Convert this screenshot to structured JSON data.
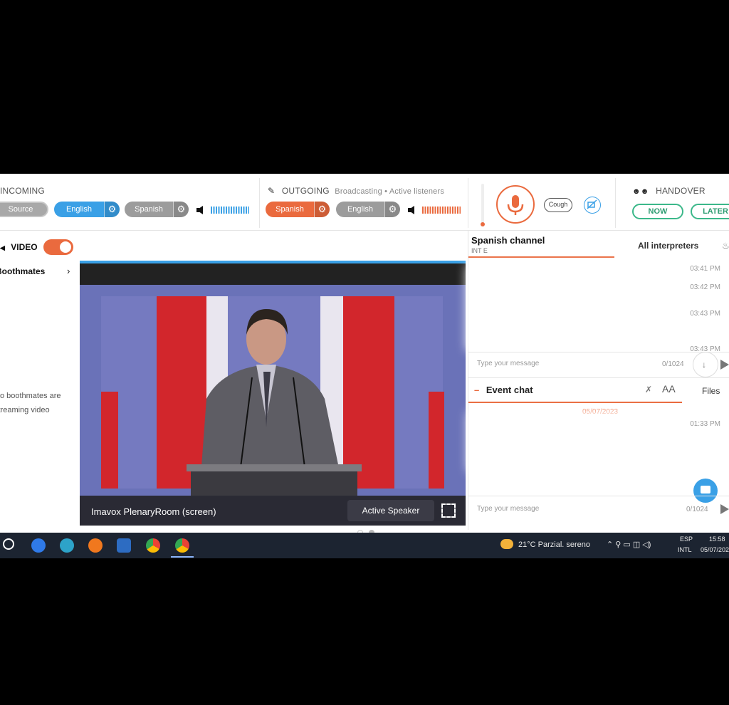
{
  "incoming": {
    "label": "INCOMING",
    "source": "Source",
    "lang1": "English",
    "lang2": "Spanish"
  },
  "outgoing": {
    "label": "OUTGOING",
    "status": "Broadcasting • Active listeners",
    "lang1": "Spanish",
    "lang2": "English"
  },
  "mic": {
    "cough": "Cough"
  },
  "handover": {
    "label": "HANDOVER",
    "now": "NOW",
    "later": "LATER"
  },
  "left": {
    "video_label": "VIDEO",
    "boothmates": "Boothmates",
    "no_stream_line1": "No boothmates are",
    "no_stream_line2": "streaming video"
  },
  "video": {
    "room_label": "Imavox PlenaryRoom (screen)",
    "active_speaker": "Active Speaker"
  },
  "chat": {
    "channel_title": "Spanish channel",
    "channel_sub": "INT E",
    "all_interpreters": "All interpreters",
    "times": [
      "03:41 PM",
      "03:42 PM",
      "03:43 PM",
      "03:43 PM"
    ],
    "placeholder": "Type your message",
    "count": "0/1024",
    "event_chat": "Event chat",
    "font_btn": "AA",
    "files": "Files",
    "event_date": "05/07/2023",
    "event_time": "01:33 PM"
  },
  "taskbar": {
    "weather": "21°C  Parzial. sereno",
    "lang_top": "ESP",
    "lang_bottom": "INTL",
    "time": "15:58",
    "date": "05/07/202"
  },
  "colors": {
    "accent_orange": "#ea6a3e",
    "accent_blue": "#3aa0e6",
    "handover_green": "#3cb88a"
  }
}
